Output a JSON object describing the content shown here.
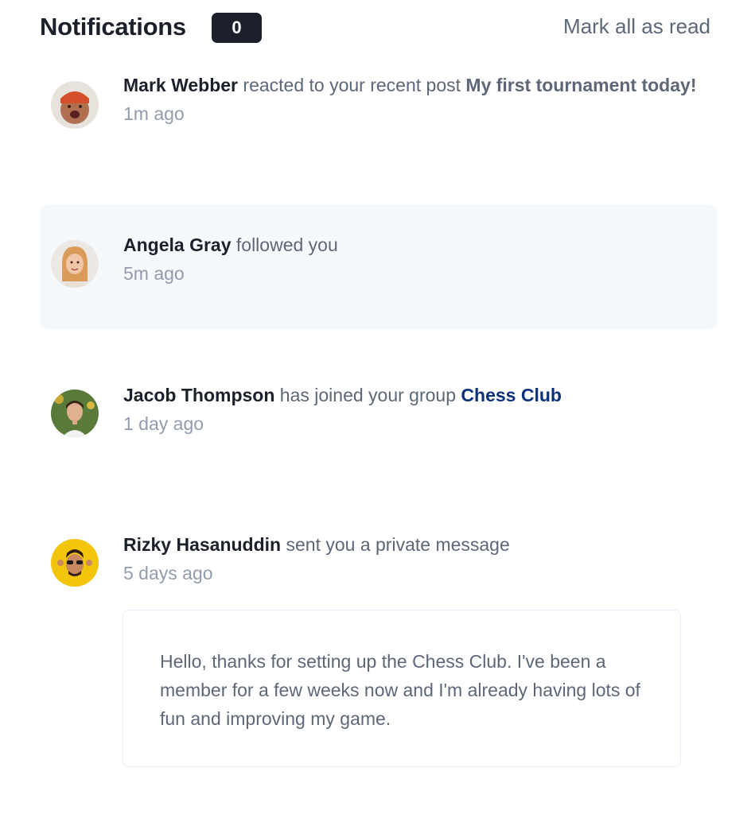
{
  "header": {
    "title": "Notifications",
    "unread_count": "0",
    "mark_all_label": "Mark all as read"
  },
  "notifications": [
    {
      "avatar_icon": "avatar-mark-webber",
      "name": "Mark Webber",
      "action": "reacted to your recent post",
      "target": "My first tournament today!",
      "time": "1m ago"
    },
    {
      "avatar_icon": "avatar-angela-gray",
      "name": "Angela Gray",
      "action": "followed you",
      "time": "5m ago"
    },
    {
      "avatar_icon": "avatar-jacob-thompson",
      "name": "Jacob Thompson",
      "action": "has joined your group",
      "target": "Chess Club",
      "time": "1 day ago"
    },
    {
      "avatar_icon": "avatar-rizky-hasanuddin",
      "name": "Rizky Hasanuddin",
      "action": "sent you a private message",
      "time": "5 days ago",
      "message": "Hello, thanks for setting up the Chess Club. I've been a member for a few weeks now and I'm already having lots of fun and improving my game."
    }
  ],
  "colors": {
    "dark_text": "#1c202b",
    "body_text": "#5e6778",
    "muted_text": "#939cad",
    "group_link": "#0a327b",
    "highlight_bg": "#f6f9fc"
  }
}
